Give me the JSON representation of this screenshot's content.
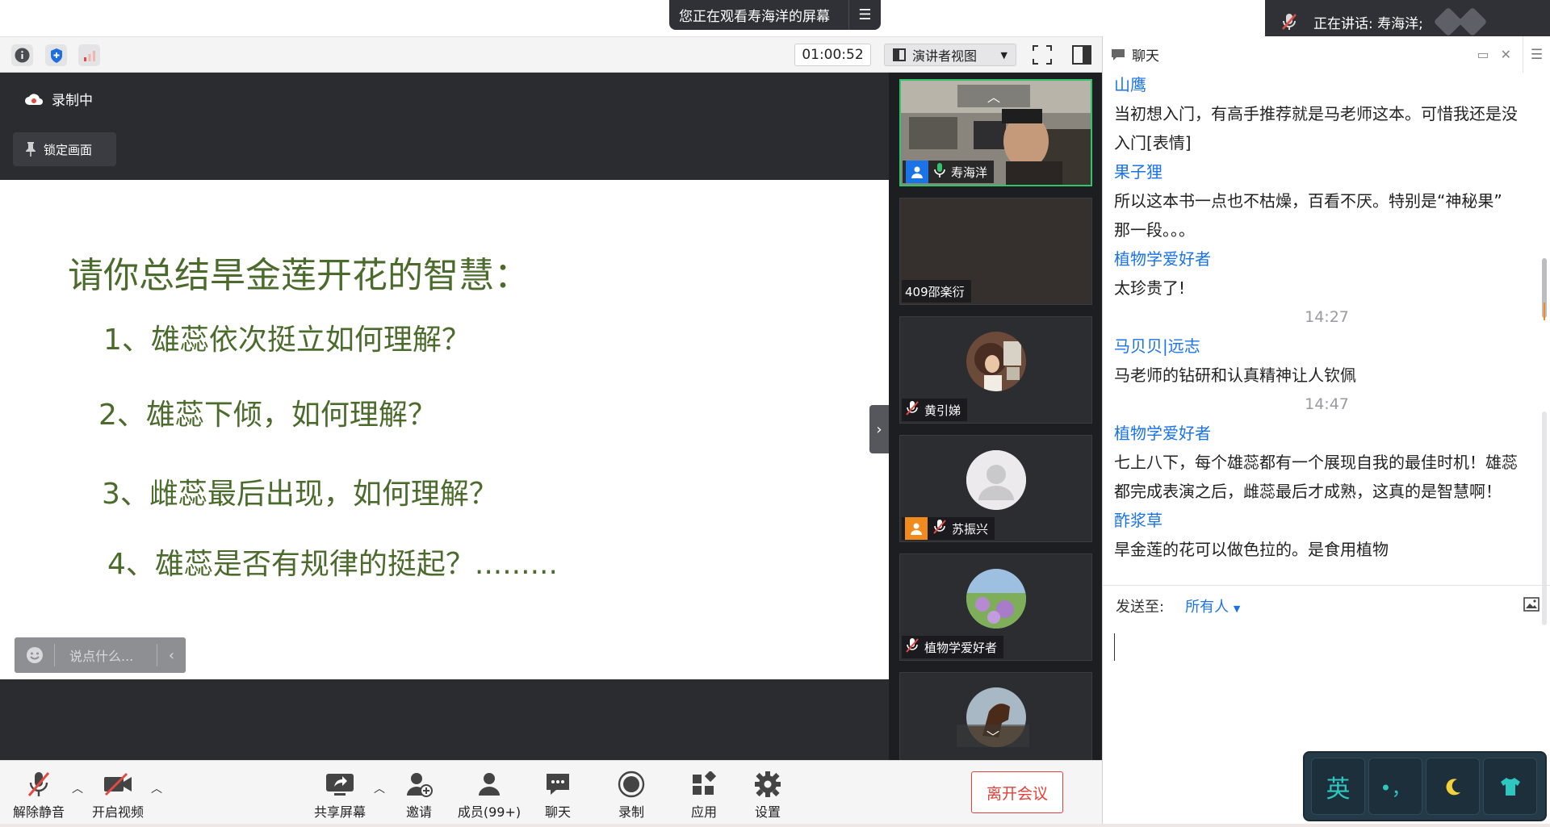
{
  "banner": {
    "viewing_text": "您正在观看寿海洋的屏幕",
    "menu_icon": "list-menu-icon"
  },
  "speaker": {
    "label": "正在讲话: 寿海洋;"
  },
  "toolbar": {
    "timer": "01:00:52",
    "view_mode": "演讲者视图"
  },
  "share": {
    "recording_label": "录制中",
    "lock_label": "锁定画面",
    "slide_title": "请你总结旱金莲开花的智慧：",
    "questions": [
      "1、雄蕊依次挺立如何理解？",
      "2、雄蕊下倾，如何理解？",
      "3、雌蕊最后出现，如何理解？",
      "4、雄蕊是否有规律的挺起？........."
    ],
    "comment_placeholder": "说点什么..."
  },
  "participants": [
    {
      "name": "寿海洋",
      "active": true
    },
    {
      "name": "409邵楽衍"
    },
    {
      "name": "黄引娣"
    },
    {
      "name": "苏振兴"
    },
    {
      "name": "植物学爱好者"
    },
    {
      "name": ""
    }
  ],
  "chat": {
    "title": "聊天",
    "messages": [
      {
        "sender": "山鹰",
        "text": [
          "当初想入门，有高手推荐就是马老师这本。可惜我还是没",
          "入门[表情]"
        ]
      },
      {
        "sender": "果子狸",
        "text": [
          "所以这本书一点也不枯燥，百看不厌。特别是“神秘果”",
          "那一段。。。"
        ]
      },
      {
        "sender": "植物学爱好者",
        "text": [
          "太珍贵了!"
        ]
      },
      {
        "time": "14:27"
      },
      {
        "sender": "马贝贝|远志",
        "text": [
          "马老师的钻研和认真精神让人钦佩"
        ]
      },
      {
        "time": "14:47"
      },
      {
        "sender": "植物学爱好者",
        "text": [
          "七上八下，每个雄蕊都有一个展现自我的最佳时机！雄蕊",
          "都完成表演之后，雌蕊最后才成熟，这真的是智慧啊！"
        ]
      },
      {
        "sender": "酢浆草",
        "text": [
          "旱金莲的花可以做色拉的。是食用植物"
        ]
      }
    ],
    "send_to_label": "发送至:",
    "send_to_target": "所有人"
  },
  "bottombar": {
    "unmute": "解除静音",
    "video": "开启视频",
    "share": "共享屏幕",
    "invite": "邀请",
    "members": "成员(99+)",
    "chat": "聊天",
    "record": "录制",
    "apps": "应用",
    "settings": "设置",
    "leave": "离开会议"
  },
  "ime": {
    "lang_key": "英",
    "punct_key": "•，",
    "moon_icon": "moon-icon",
    "shirt_icon": "shirt-icon"
  },
  "colors": {
    "accent_blue": "#1a73e8",
    "active_green": "#31c46b",
    "leave_red": "#e0413a",
    "slide_green": "#4b6b2c"
  }
}
